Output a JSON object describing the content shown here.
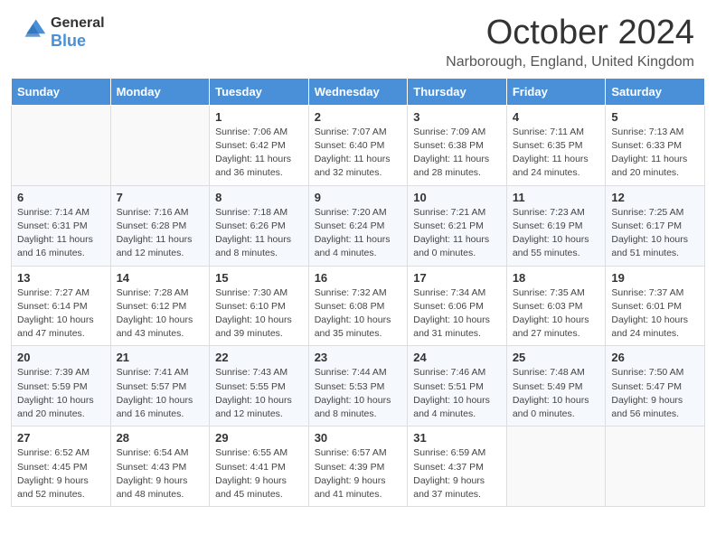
{
  "header": {
    "logo_line1": "General",
    "logo_line2": "Blue",
    "month_title": "October 2024",
    "location": "Narborough, England, United Kingdom"
  },
  "weekdays": [
    "Sunday",
    "Monday",
    "Tuesday",
    "Wednesday",
    "Thursday",
    "Friday",
    "Saturday"
  ],
  "weeks": [
    [
      {
        "day": "",
        "info": ""
      },
      {
        "day": "",
        "info": ""
      },
      {
        "day": "1",
        "info": "Sunrise: 7:06 AM\nSunset: 6:42 PM\nDaylight: 11 hours and 36 minutes."
      },
      {
        "day": "2",
        "info": "Sunrise: 7:07 AM\nSunset: 6:40 PM\nDaylight: 11 hours and 32 minutes."
      },
      {
        "day": "3",
        "info": "Sunrise: 7:09 AM\nSunset: 6:38 PM\nDaylight: 11 hours and 28 minutes."
      },
      {
        "day": "4",
        "info": "Sunrise: 7:11 AM\nSunset: 6:35 PM\nDaylight: 11 hours and 24 minutes."
      },
      {
        "day": "5",
        "info": "Sunrise: 7:13 AM\nSunset: 6:33 PM\nDaylight: 11 hours and 20 minutes."
      }
    ],
    [
      {
        "day": "6",
        "info": "Sunrise: 7:14 AM\nSunset: 6:31 PM\nDaylight: 11 hours and 16 minutes."
      },
      {
        "day": "7",
        "info": "Sunrise: 7:16 AM\nSunset: 6:28 PM\nDaylight: 11 hours and 12 minutes."
      },
      {
        "day": "8",
        "info": "Sunrise: 7:18 AM\nSunset: 6:26 PM\nDaylight: 11 hours and 8 minutes."
      },
      {
        "day": "9",
        "info": "Sunrise: 7:20 AM\nSunset: 6:24 PM\nDaylight: 11 hours and 4 minutes."
      },
      {
        "day": "10",
        "info": "Sunrise: 7:21 AM\nSunset: 6:21 PM\nDaylight: 11 hours and 0 minutes."
      },
      {
        "day": "11",
        "info": "Sunrise: 7:23 AM\nSunset: 6:19 PM\nDaylight: 10 hours and 55 minutes."
      },
      {
        "day": "12",
        "info": "Sunrise: 7:25 AM\nSunset: 6:17 PM\nDaylight: 10 hours and 51 minutes."
      }
    ],
    [
      {
        "day": "13",
        "info": "Sunrise: 7:27 AM\nSunset: 6:14 PM\nDaylight: 10 hours and 47 minutes."
      },
      {
        "day": "14",
        "info": "Sunrise: 7:28 AM\nSunset: 6:12 PM\nDaylight: 10 hours and 43 minutes."
      },
      {
        "day": "15",
        "info": "Sunrise: 7:30 AM\nSunset: 6:10 PM\nDaylight: 10 hours and 39 minutes."
      },
      {
        "day": "16",
        "info": "Sunrise: 7:32 AM\nSunset: 6:08 PM\nDaylight: 10 hours and 35 minutes."
      },
      {
        "day": "17",
        "info": "Sunrise: 7:34 AM\nSunset: 6:06 PM\nDaylight: 10 hours and 31 minutes."
      },
      {
        "day": "18",
        "info": "Sunrise: 7:35 AM\nSunset: 6:03 PM\nDaylight: 10 hours and 27 minutes."
      },
      {
        "day": "19",
        "info": "Sunrise: 7:37 AM\nSunset: 6:01 PM\nDaylight: 10 hours and 24 minutes."
      }
    ],
    [
      {
        "day": "20",
        "info": "Sunrise: 7:39 AM\nSunset: 5:59 PM\nDaylight: 10 hours and 20 minutes."
      },
      {
        "day": "21",
        "info": "Sunrise: 7:41 AM\nSunset: 5:57 PM\nDaylight: 10 hours and 16 minutes."
      },
      {
        "day": "22",
        "info": "Sunrise: 7:43 AM\nSunset: 5:55 PM\nDaylight: 10 hours and 12 minutes."
      },
      {
        "day": "23",
        "info": "Sunrise: 7:44 AM\nSunset: 5:53 PM\nDaylight: 10 hours and 8 minutes."
      },
      {
        "day": "24",
        "info": "Sunrise: 7:46 AM\nSunset: 5:51 PM\nDaylight: 10 hours and 4 minutes."
      },
      {
        "day": "25",
        "info": "Sunrise: 7:48 AM\nSunset: 5:49 PM\nDaylight: 10 hours and 0 minutes."
      },
      {
        "day": "26",
        "info": "Sunrise: 7:50 AM\nSunset: 5:47 PM\nDaylight: 9 hours and 56 minutes."
      }
    ],
    [
      {
        "day": "27",
        "info": "Sunrise: 6:52 AM\nSunset: 4:45 PM\nDaylight: 9 hours and 52 minutes."
      },
      {
        "day": "28",
        "info": "Sunrise: 6:54 AM\nSunset: 4:43 PM\nDaylight: 9 hours and 48 minutes."
      },
      {
        "day": "29",
        "info": "Sunrise: 6:55 AM\nSunset: 4:41 PM\nDaylight: 9 hours and 45 minutes."
      },
      {
        "day": "30",
        "info": "Sunrise: 6:57 AM\nSunset: 4:39 PM\nDaylight: 9 hours and 41 minutes."
      },
      {
        "day": "31",
        "info": "Sunrise: 6:59 AM\nSunset: 4:37 PM\nDaylight: 9 hours and 37 minutes."
      },
      {
        "day": "",
        "info": ""
      },
      {
        "day": "",
        "info": ""
      }
    ]
  ]
}
